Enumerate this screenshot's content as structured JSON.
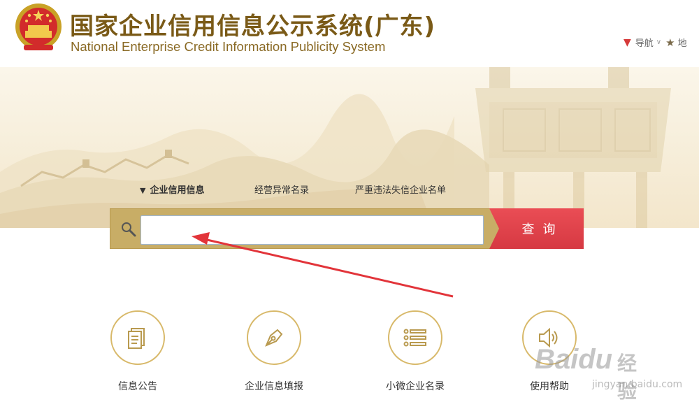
{
  "header": {
    "title_cn": "国家企业信用信息公示系统(广东)",
    "title_en": "National Enterprise Credit Information Publicity System",
    "nav_label": "导航",
    "map_label": "地"
  },
  "tabs": [
    {
      "label": "企业信用信息",
      "active": true
    },
    {
      "label": "经营异常名录",
      "active": false
    },
    {
      "label": "严重违法失信企业名单",
      "active": false
    }
  ],
  "search": {
    "placeholder": "",
    "value": "",
    "button_label": "查询"
  },
  "services": [
    {
      "label": "信息公告",
      "icon": "document-icon"
    },
    {
      "label": "企业信息填报",
      "icon": "pen-icon"
    },
    {
      "label": "小微企业名录",
      "icon": "list-icon"
    },
    {
      "label": "使用帮助",
      "icon": "speaker-icon"
    }
  ],
  "watermark": {
    "logo": "Baidu",
    "cn": "经验",
    "url": "jingyan.baidu.com"
  },
  "colors": {
    "brand_gold": "#7a5a17",
    "search_frame": "#c8ad66",
    "search_button": "#e0434c",
    "circle_border": "#d8b96a",
    "annotation_arrow": "#e2343a"
  }
}
